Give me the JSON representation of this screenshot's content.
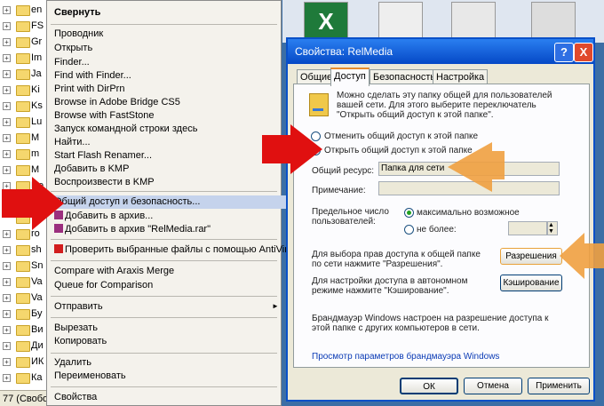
{
  "tree": {
    "rows": [
      {
        "label": "en",
        "expand": "+"
      },
      {
        "label": "FS",
        "expand": "+"
      },
      {
        "label": "Gr",
        "expand": "+"
      },
      {
        "label": "Im",
        "expand": "+"
      },
      {
        "label": "Ja",
        "expand": "+"
      },
      {
        "label": "Ki",
        "expand": "+"
      },
      {
        "label": "Ks",
        "expand": "+"
      },
      {
        "label": "Lu",
        "expand": "+"
      },
      {
        "label": "M",
        "expand": "+"
      },
      {
        "label": "m",
        "expand": "+"
      },
      {
        "label": "M",
        "expand": "+"
      },
      {
        "label": "Re",
        "expand": "+"
      },
      {
        "label": "Re",
        "expand": "-"
      },
      {
        "label": "",
        "expand": ""
      },
      {
        "label": "ro",
        "expand": "+"
      },
      {
        "label": "sh",
        "expand": "+"
      },
      {
        "label": "Sn",
        "expand": "+"
      },
      {
        "label": "Va",
        "expand": "+"
      },
      {
        "label": "Va",
        "expand": "+"
      },
      {
        "label": "Бу",
        "expand": "+"
      },
      {
        "label": "Ви",
        "expand": "+"
      },
      {
        "label": "Ди",
        "expand": "+"
      },
      {
        "label": "ИК",
        "expand": "+"
      },
      {
        "label": "Ка",
        "expand": "+"
      }
    ],
    "status": "77 (Свобо"
  },
  "context_menu": {
    "items": [
      "Свернуть",
      "Проводник",
      "Открыть",
      "Finder...",
      "Find with Finder...",
      "Print with DirPrn",
      "Browse in Adobe Bridge CS5",
      "Browse with FastStone",
      "Запуск командной строки здесь",
      "Найти...",
      "Start Flash Renamer...",
      "Добавить в KMP",
      "Воспроизвести в KMP",
      "Общий доступ и безопасность...",
      "Добавить в архив...",
      "Добавить в архив \"RelMedia.rar\"",
      "Проверить выбранные файлы с помощью AntiVir",
      "Compare with Araxis Merge",
      "Queue for Comparison",
      "Отправить",
      "Вырезать",
      "Копировать",
      "Удалить",
      "Переименовать",
      "Свойства"
    ]
  },
  "dialog": {
    "title": "Свойства: RelMedia",
    "help": "?",
    "close": "X",
    "tabs": [
      "Общие",
      "Доступ",
      "Безопасность",
      "Настройка"
    ],
    "info_line1": "Можно сделать эту папку общей для пользователей",
    "info_line2": "вашей сети. Для этого выберите переключатель",
    "info_line3": "\"Открыть общий доступ к этой папке\".",
    "radio_disable": "Отменить общий доступ к этой папке",
    "radio_enable": "Открыть общий доступ к этой папке",
    "share_label": "Общий ресурс:",
    "share_value": "Папка для сети",
    "comment_label": "Примечание:",
    "comment_value": "",
    "limit_label1": "Предельное число",
    "limit_label2": "пользователей:",
    "limit_max": "максимально возможное",
    "limit_no_more": "не более:",
    "perm_text1": "Для выбора прав доступа к общей папке",
    "perm_text2": "по сети нажмите \"Разрешения\".",
    "perm_button": "Разрешения",
    "cache_text1": "Для настройки доступа в автономном",
    "cache_text2": "режиме нажмите \"Кэширование\".",
    "cache_button": "Кэширование",
    "firewall_text1": "Брандмауэр Windows настроен на разрешение доступа к",
    "firewall_text2": "этой папке с других компьютеров в сети.",
    "firewall_link": "Просмотр параметров брандмауэра Windows",
    "ok": "ОК",
    "cancel": "Отмена",
    "apply": "Применить"
  },
  "colors": {
    "red_arrow": "#e01010",
    "orange_arrow": "#f0a040",
    "highlight": "#c5d3ec"
  }
}
